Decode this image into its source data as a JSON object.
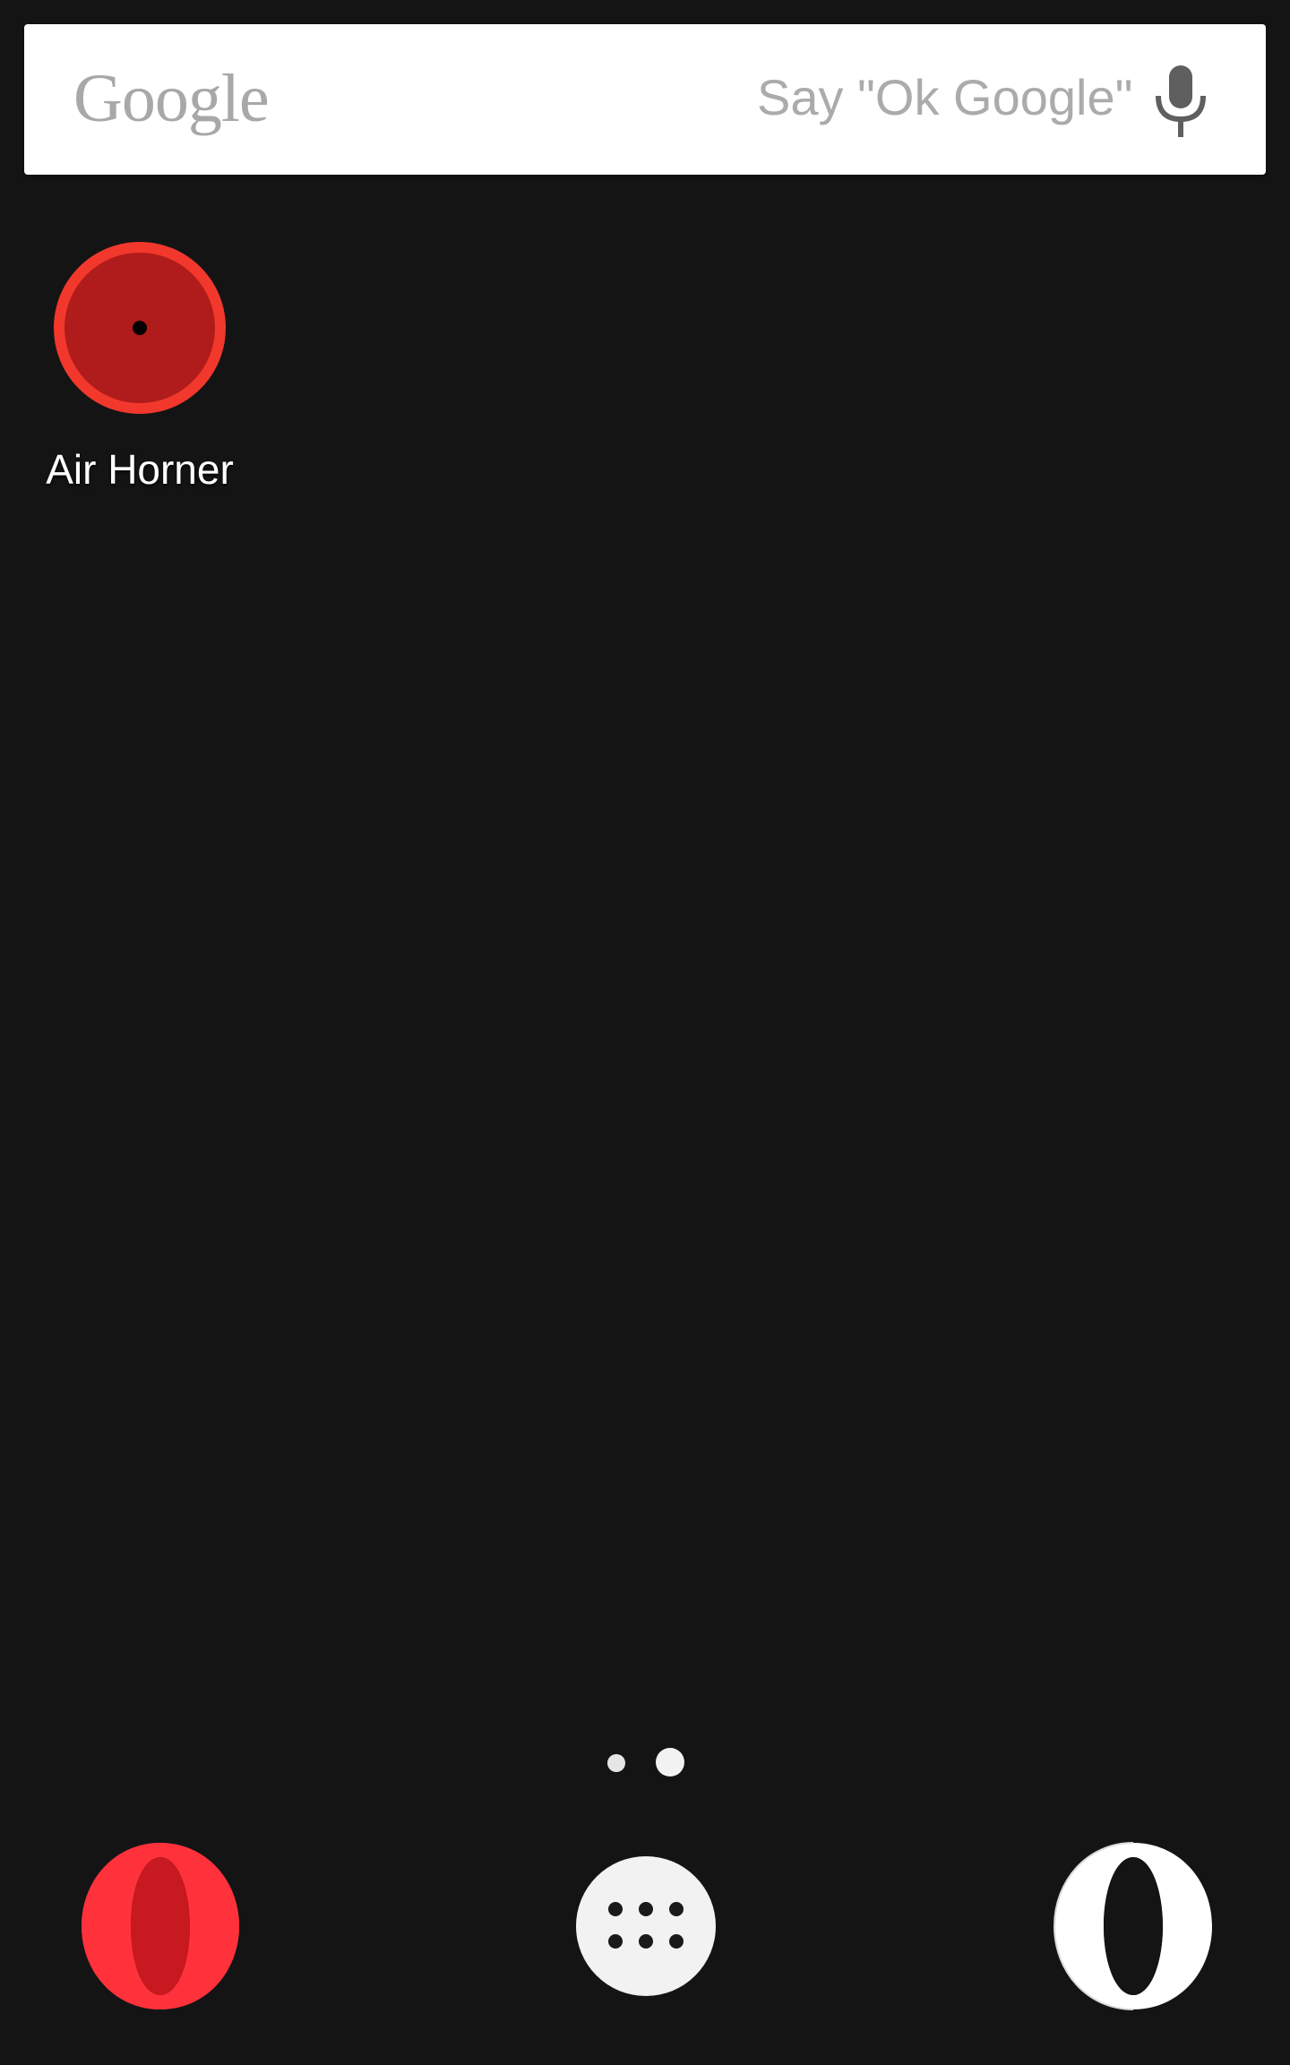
{
  "search_bar": {
    "logo_text": "Google",
    "hint_text": "Say \"Ok Google\"",
    "mic_icon": "microphone-icon"
  },
  "home_screen": {
    "apps": [
      {
        "label": "Air Horner",
        "icon": "air-horner-icon",
        "colors": {
          "ring": "#f2382c",
          "fill": "#b01b1b",
          "center": "#000000"
        }
      }
    ]
  },
  "page_indicator": {
    "total_pages": 2,
    "current_page": 2
  },
  "dock": {
    "items": [
      {
        "icon": "opera-red-icon",
        "color": "#ff323c"
      },
      {
        "icon": "app-drawer-icon",
        "color": "#f2f2f2"
      },
      {
        "icon": "opera-white-icon",
        "color": "#ffffff"
      }
    ]
  },
  "colors": {
    "background": "#141414",
    "search_bar_bg": "#ffffff",
    "hint_text": "#ababab",
    "logo_text": "#a8a8a8"
  }
}
